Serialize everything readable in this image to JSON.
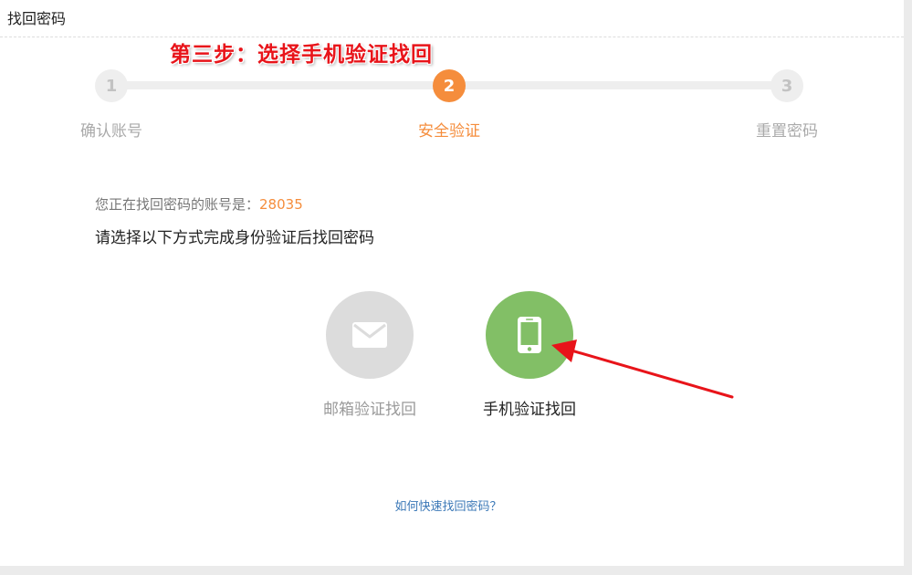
{
  "header": {
    "title": "找回密码"
  },
  "annotation": {
    "text": "第三步：选择手机验证找回"
  },
  "steps": [
    {
      "number": "1",
      "label": "确认账号",
      "active": false
    },
    {
      "number": "2",
      "label": "安全验证",
      "active": true
    },
    {
      "number": "3",
      "label": "重置密码",
      "active": false
    }
  ],
  "account": {
    "prefix": "您正在找回密码的账号是：",
    "value": "28035"
  },
  "instruction": "请选择以下方式完成身份验证后找回密码",
  "methods": {
    "email": {
      "label": "邮箱验证找回",
      "icon": "envelope-icon"
    },
    "phone": {
      "label": "手机验证找回",
      "icon": "smartphone-icon"
    }
  },
  "help_link": {
    "text": "如何快速找回密码？"
  },
  "colors": {
    "accent": "#f58d3c",
    "phone_green": "#82bf66",
    "email_gray": "#dcdcdc",
    "annotation_red": "#e8141a",
    "link_blue": "#3b78b7"
  }
}
